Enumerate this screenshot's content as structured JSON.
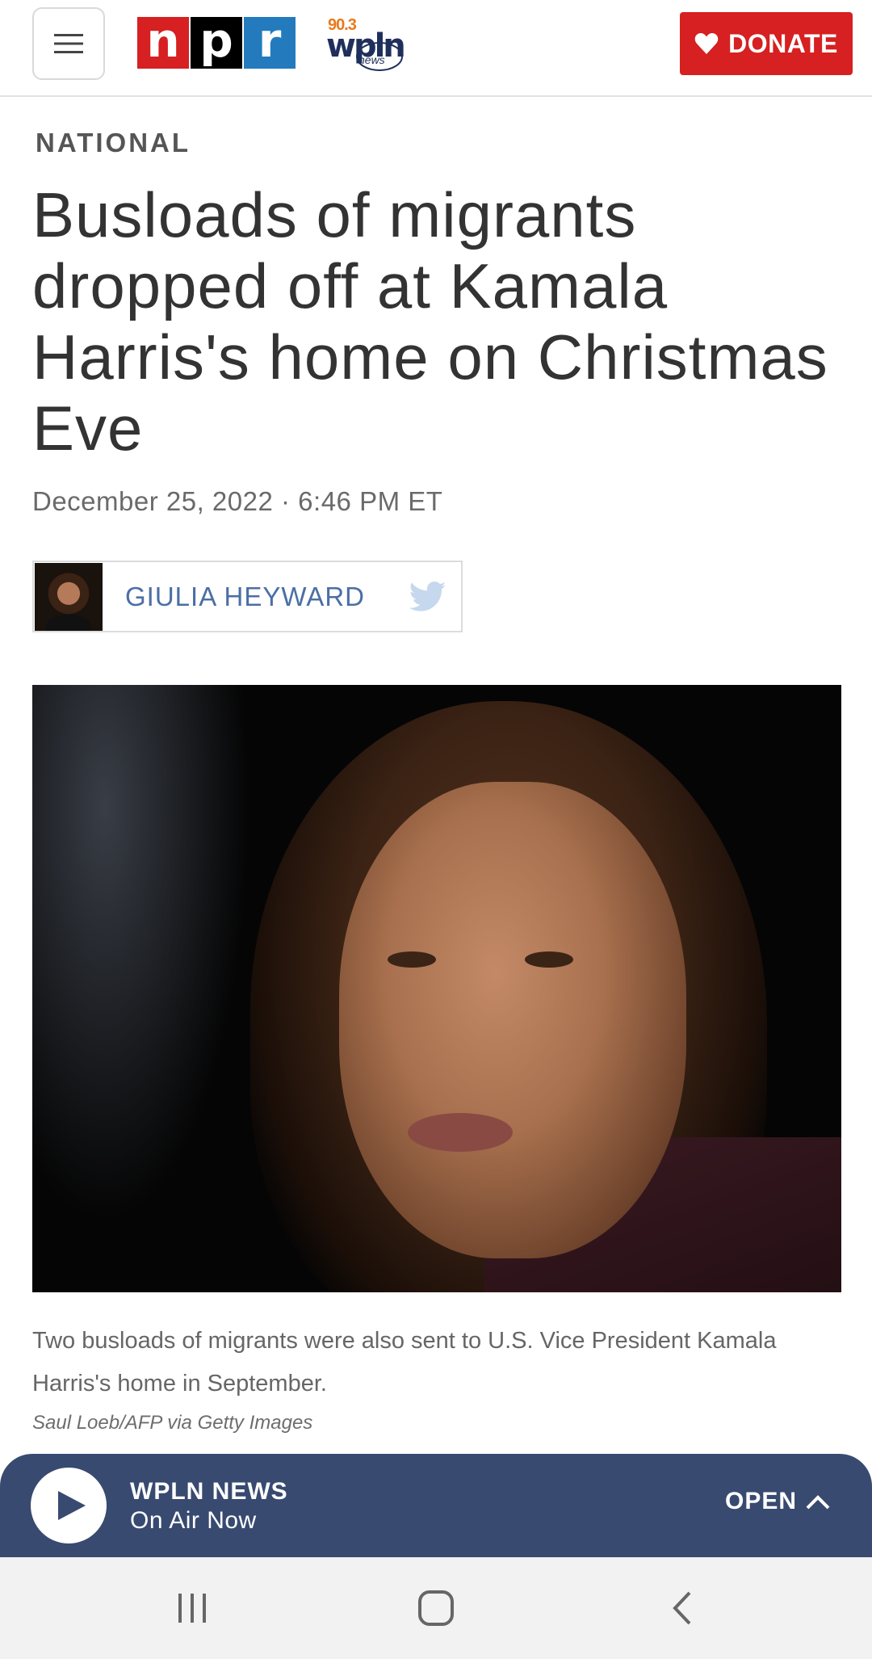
{
  "header": {
    "npr_letters": [
      "n",
      "p",
      "r"
    ],
    "station_logo": {
      "frequency": "90.3",
      "name": "wpln",
      "sub": "news"
    },
    "donate_label": "DONATE",
    "colors": {
      "npr_red": "#d62021",
      "npr_black": "#000000",
      "npr_blue": "#237bbd",
      "donate_bg": "#d62021"
    }
  },
  "article": {
    "section": "NATIONAL",
    "headline": "Busloads of migrants dropped off at Kamala Harris's home on Christmas Eve",
    "dateline": "December 25, 2022 · 6:46 PM ET",
    "author": "GIULIA HEYWARD",
    "caption": "Two busloads of migrants were also sent to U.S. Vice President Kamala Harris's home in September.",
    "credit": "Saul Loeb/AFP via Getty Images"
  },
  "player": {
    "station": "WPLN NEWS",
    "status": "On Air Now",
    "open_label": "OPEN",
    "bg_color": "#384a70"
  },
  "icons": {
    "menu": "hamburger-icon",
    "donate": "heart-icon",
    "author_social": "twitter-icon",
    "player_play": "play-icon",
    "player_open": "chevron-up-icon",
    "nav_recents": "recents-icon",
    "nav_home": "home-icon",
    "nav_back": "back-icon"
  }
}
